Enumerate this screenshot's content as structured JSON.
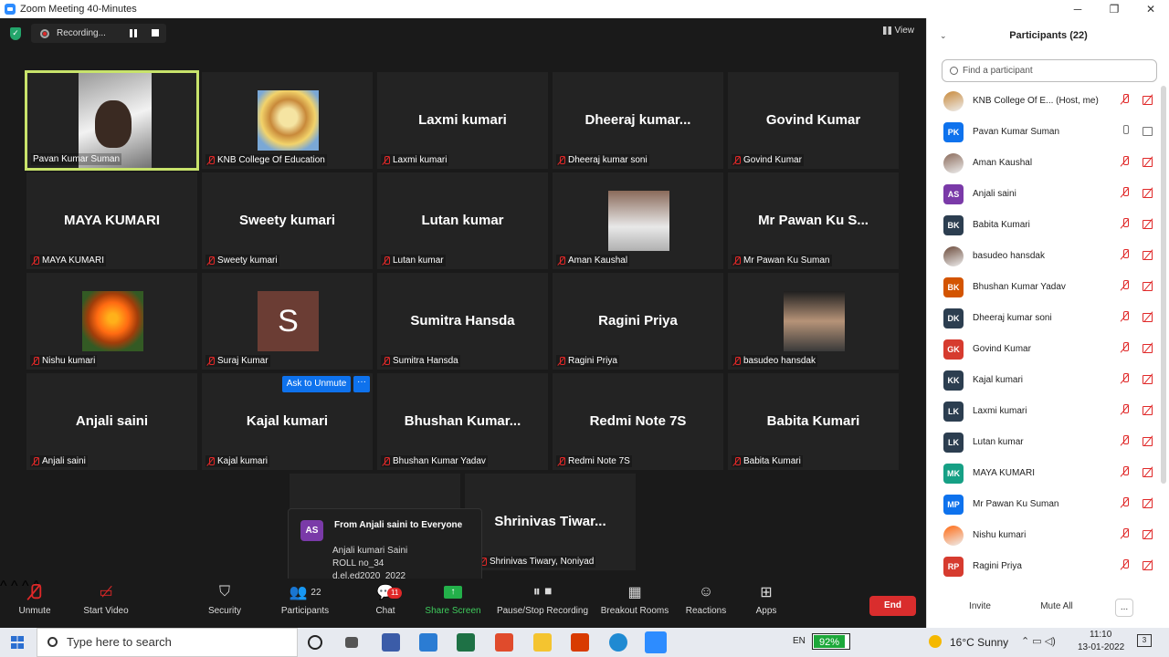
{
  "window": {
    "title": "Zoom Meeting 40-Minutes",
    "controls": [
      "─",
      "❐",
      "✕"
    ]
  },
  "recording": {
    "label": "Recording..."
  },
  "view": {
    "label": "View"
  },
  "tiles": [
    {
      "big": "",
      "name": "Pavan Kumar Suman",
      "type": "video"
    },
    {
      "big": "",
      "name": "KNB College Of Education",
      "type": "logo"
    },
    {
      "big": "Laxmi kumari",
      "name": "Laxmi kumari"
    },
    {
      "big": "Dheeraj  kumar...",
      "name": "Dheeraj kumar soni"
    },
    {
      "big": "Govind Kumar",
      "name": "Govind Kumar"
    },
    {
      "big": "MAYA KUMARI",
      "name": "MAYA KUMARI"
    },
    {
      "big": "Sweety kumari",
      "name": "Sweety kumari"
    },
    {
      "big": "Lutan kumar",
      "name": "Lutan kumar"
    },
    {
      "big": "",
      "name": "Aman Kaushal",
      "type": "aman"
    },
    {
      "big": "Mr  Pawan Ku S...",
      "name": "Mr  Pawan Ku Suman"
    },
    {
      "big": "",
      "name": "Nishu kumari",
      "type": "flower"
    },
    {
      "big": "",
      "name": "Suraj Kumar",
      "type": "s",
      "letter": "S"
    },
    {
      "big": "Sumitra Hansda",
      "name": "Sumitra Hansda"
    },
    {
      "big": "Ragini  Priya",
      "name": "Ragini  Priya"
    },
    {
      "big": "",
      "name": "basudeo hansdak",
      "type": "basu"
    },
    {
      "big": "Anjali saini",
      "name": "Anjali saini"
    },
    {
      "big": "Kajal kumari",
      "name": "Kajal kumari"
    },
    {
      "big": "Bhushan  Kumar...",
      "name": "Bhushan Kumar Yadav"
    },
    {
      "big": "Redmi Note 7S",
      "name": "Redmi Note 7S"
    },
    {
      "big": "Babita Kumari",
      "name": "Babita Kumari"
    },
    {
      "big": "",
      "name": ""
    },
    {
      "big": "Shrinivas  Tiwar...",
      "name": "Shrinivas Tiwary, Noniyad"
    }
  ],
  "ask_to_unmute": "Ask to Unmute",
  "more_dots": "···",
  "chat_popup": {
    "avatar": "AS",
    "from": "From Anjali saini to Everyone",
    "lines": [
      "Anjali kumari Saini",
      "ROLL no_34",
      "d.el.ed2020_2022"
    ]
  },
  "toolbar": {
    "unmute": "Unmute",
    "start_video": "Start Video",
    "security": "Security",
    "participants": "Participants",
    "participants_count": "22",
    "chat": "Chat",
    "chat_badge": "11",
    "share_screen": "Share Screen",
    "pause_stop": "Pause/Stop Recording",
    "breakout": "Breakout Rooms",
    "reactions": "Reactions",
    "apps": "Apps",
    "end": "End"
  },
  "panel": {
    "title": "Participants (22)",
    "search_placeholder": "Find a participant",
    "participants": [
      {
        "initials": "",
        "name": "KNB College Of E...  (Host, me)",
        "color": "#c8893a",
        "photo": true
      },
      {
        "initials": "PK",
        "name": "Pavan Kumar Suman",
        "color": "#0e72ed",
        "on": true
      },
      {
        "initials": "",
        "name": "Aman Kaushal",
        "color": "#8a6a5a",
        "photo": true
      },
      {
        "initials": "AS",
        "name": "Anjali saini",
        "color": "#7a3aa8"
      },
      {
        "initials": "BK",
        "name": "Babita Kumari",
        "color": "#2c3e50"
      },
      {
        "initials": "",
        "name": "basudeo hansdak",
        "color": "#6b4a3a",
        "photo": true
      },
      {
        "initials": "BK",
        "name": "Bhushan Kumar Yadav",
        "color": "#d35400"
      },
      {
        "initials": "DK",
        "name": "Dheeraj kumar soni",
        "color": "#2c3e50"
      },
      {
        "initials": "GK",
        "name": "Govind Kumar",
        "color": "#d63b2f"
      },
      {
        "initials": "KK",
        "name": "Kajal kumari",
        "color": "#2c3e50"
      },
      {
        "initials": "LK",
        "name": "Laxmi kumari",
        "color": "#2c3e50"
      },
      {
        "initials": "LK",
        "name": "Lutan kumar",
        "color": "#2c3e50"
      },
      {
        "initials": "MK",
        "name": "MAYA KUMARI",
        "color": "#16a085"
      },
      {
        "initials": "MP",
        "name": "Mr  Pawan Ku Suman",
        "color": "#0e72ed"
      },
      {
        "initials": "",
        "name": "Nishu kumari",
        "color": "#ff6a12",
        "photo": true
      },
      {
        "initials": "RP",
        "name": "Ragini  Priya",
        "color": "#d63b2f"
      }
    ],
    "invite": "Invite",
    "mute_all": "Mute All",
    "more": "..."
  },
  "taskbar": {
    "search": "Type here to search",
    "lang": "EN",
    "battery": "92%",
    "weather": "16°C  Sunny",
    "time": "11:10",
    "date": "13-01-2022",
    "notif": "3"
  }
}
